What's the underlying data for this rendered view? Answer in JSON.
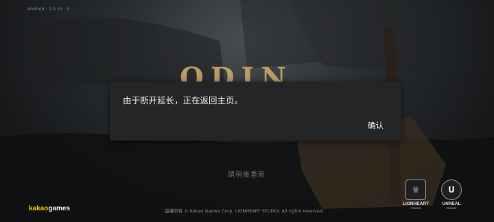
{
  "header": {
    "version_text": "Android : 1.0.15 : 0"
  },
  "background": {
    "game_logo_text": "ODIN",
    "loading_text": "請稍後重新"
  },
  "footer": {
    "brand_part1": "kakao",
    "brand_part2": "games",
    "copyright": "版權所有 © Kakao Games Corp. LIONHEART STUDIO. All rights reserved.",
    "lionheart_label": "LIONHEART",
    "lionheart_sub": "STUDIO",
    "unreal_label": "UNREAL",
    "unreal_sub": "ENGINE"
  },
  "dialog": {
    "message": "由于断开延长，正在返回主页。",
    "confirm_label": "确认"
  }
}
